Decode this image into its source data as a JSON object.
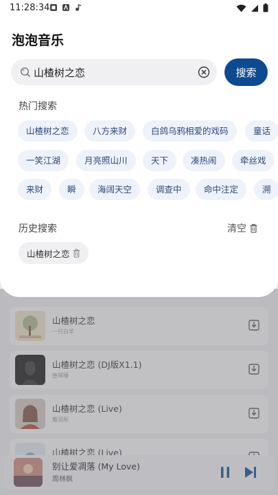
{
  "status_bar": {
    "time": "11:28:34"
  },
  "app": {
    "title": "泡泡音乐"
  },
  "search": {
    "value": "山楂树之恋",
    "button_label": "搜索"
  },
  "hot_search": {
    "title": "热门搜索",
    "rows": [
      [
        "山楂树之恋",
        "八方来财",
        "白鸽乌鸦相爱的戏码",
        "童话"
      ],
      [
        "一笑江湖",
        "月亮照山川",
        "天下",
        "凑热闹",
        "牵丝戏"
      ],
      [
        "来财",
        "瞬",
        "海阔天空",
        "调查中",
        "命中注定",
        "溯"
      ]
    ]
  },
  "history": {
    "title": "历史搜索",
    "clear_label": "清空",
    "items": [
      "山楂树之恋"
    ]
  },
  "results": [
    {
      "title": "山楂树之恋",
      "artist": "一只白羊"
    },
    {
      "title": "山楂树之恋 (DJ版X1.1)",
      "artist": "德琴睡"
    },
    {
      "title": "山楂树之恋 (Live)",
      "artist": "戴羽彤"
    },
    {
      "title": "山楂树之恋 (Live)",
      "artist": ""
    }
  ],
  "now_playing": {
    "title": "别让爱凋落 (My Love)",
    "artist": "周林枫"
  },
  "colors": {
    "accent": "#0d4a8f",
    "chip_bg": "#eef2fa",
    "chip_text": "#2b4a7d"
  }
}
